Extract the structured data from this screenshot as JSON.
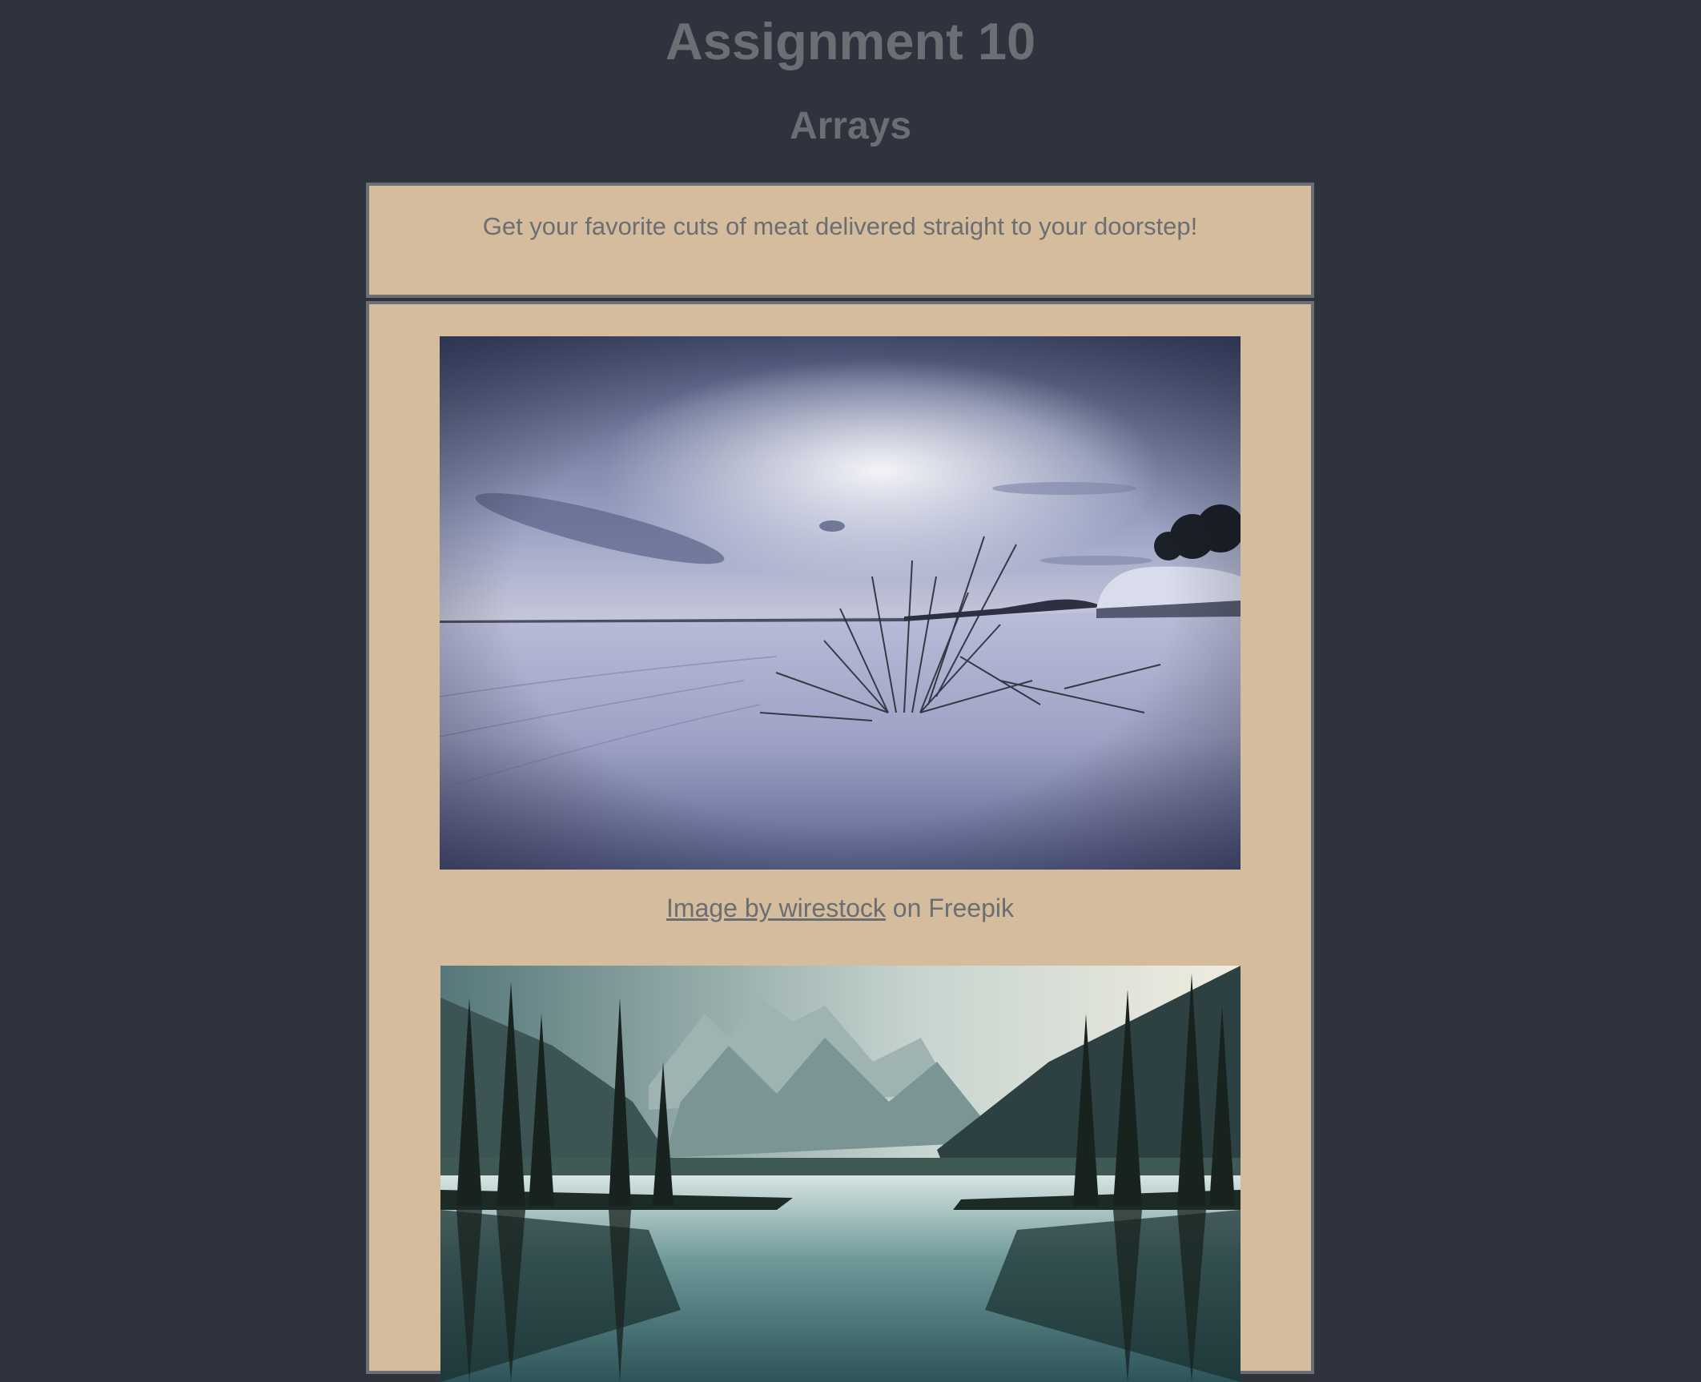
{
  "header": {
    "title": "Assignment 10",
    "subtitle": "Arrays"
  },
  "banner": {
    "text": "Get your favorite cuts of meat delivered straight to your doorstep!"
  },
  "gallery": {
    "photos": [
      {
        "description_icon": "winter-snow-landscape-photo",
        "credit_link": "Image by wirestock",
        "credit_suffix": " on Freepik"
      },
      {
        "description_icon": "mountain-lake-reflection-photo"
      }
    ]
  },
  "colors": {
    "background": "#2e333e",
    "panel": "#d4bc9c",
    "text": "#6b6e73"
  }
}
